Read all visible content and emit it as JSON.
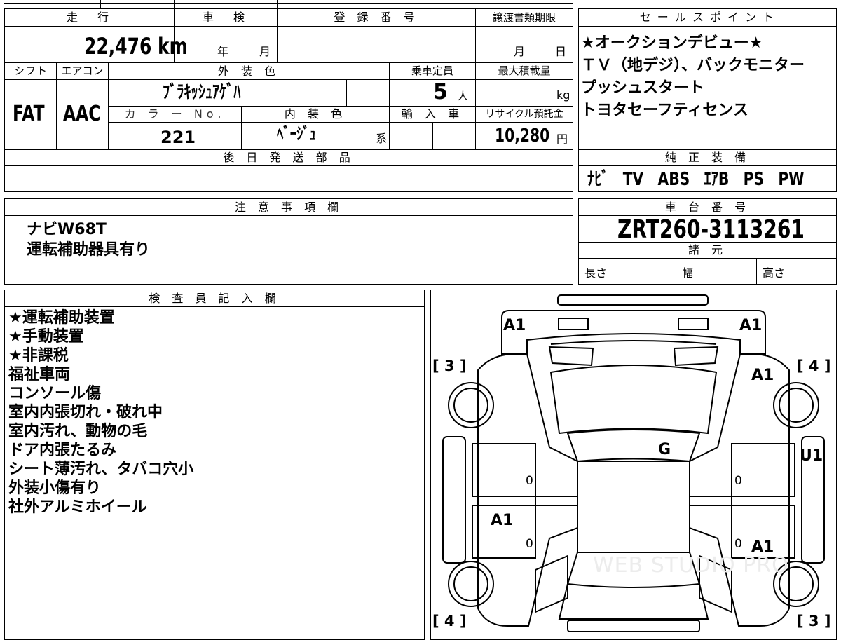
{
  "vehicle": {
    "mileage_label": "走　行",
    "mileage": "22,476",
    "mileage_unit": "km",
    "inspection_label": "車　検",
    "inspection_year_unit": "年",
    "inspection_month_unit": "月",
    "registration_label": "登 録 番 号",
    "transfer_deadline_label": "譲渡書類期限",
    "transfer_month_unit": "月",
    "transfer_day_unit": "日",
    "shift_label": "シフト",
    "shift": "FAT",
    "aircon_label": "エアコン",
    "aircon": "AAC",
    "exterior_color_label": "外 装 色",
    "exterior_color": "ﾌﾞﾗｷｯｼｭｱｹﾞﾊ",
    "capacity_label": "乗車定員",
    "capacity": "5",
    "capacity_unit": "人",
    "max_load_label": "最大積載量",
    "max_load_unit": "kg",
    "color_no_label": "カ ラ ー No.",
    "color_no": "221",
    "interior_color_label": "内 装 色",
    "interior_color": "ﾍﾞｰｼﾞｭ",
    "interior_color_suffix": "系",
    "import_label": "輸 入 車",
    "recycle_label": "リサイクル預託金",
    "recycle_fee": "10,280",
    "recycle_unit": "円",
    "later_parts_label": "後 日 発 送 部 品"
  },
  "sales_points": {
    "label": "セ ー ル ス ポ イ ン ト",
    "items": [
      "★オークションデビュー★",
      "ＴＶ（地デジ）、バックモニター",
      "プッシュスタート",
      "トヨタセーフティセンス"
    ]
  },
  "genuine_equipment": {
    "label": "純 正 装 備",
    "value": "ﾅﾋﾞ　TV　ABS　ｴｱB　PS　PW"
  },
  "notes": {
    "label": "注 意 事 項 欄",
    "lines": [
      "ナビW68T",
      "運転補助器具有り"
    ]
  },
  "chassis": {
    "label": "車 台 番 号",
    "number": "ZRT260-3113261",
    "specs_label": "諸 元",
    "length_label": "長さ",
    "width_label": "幅",
    "height_label": "高さ"
  },
  "inspector": {
    "label": "検 査 員 記 入 欄",
    "items": [
      "★運転補助装置",
      "★手動装置",
      "★非課税",
      "福祉車両",
      "コンソール傷",
      "室内内張切れ・破れ中",
      "室内汚れ、動物の毛",
      "ドア内張たるみ",
      "シート薄汚れ、タバコ穴小",
      "外装小傷有り",
      "社外アルミホイール"
    ]
  },
  "diagram": {
    "marks": {
      "front_left": "A1",
      "front_right": "A1",
      "right_front_fender": "A1",
      "roof": "G",
      "right_side": "U1",
      "left_rear_door": "A1",
      "right_rear_door": "A1",
      "door_zero_1": "0",
      "door_zero_2": "0",
      "door_zero_3": "0",
      "door_zero_4": "0"
    },
    "tires": {
      "front_left": "[ 3 ]",
      "front_right": "[ 4 ]",
      "rear_left": "[ 4 ]",
      "rear_right": "[ 3 ]"
    },
    "watermark": "WEB STUDIO PRO"
  }
}
